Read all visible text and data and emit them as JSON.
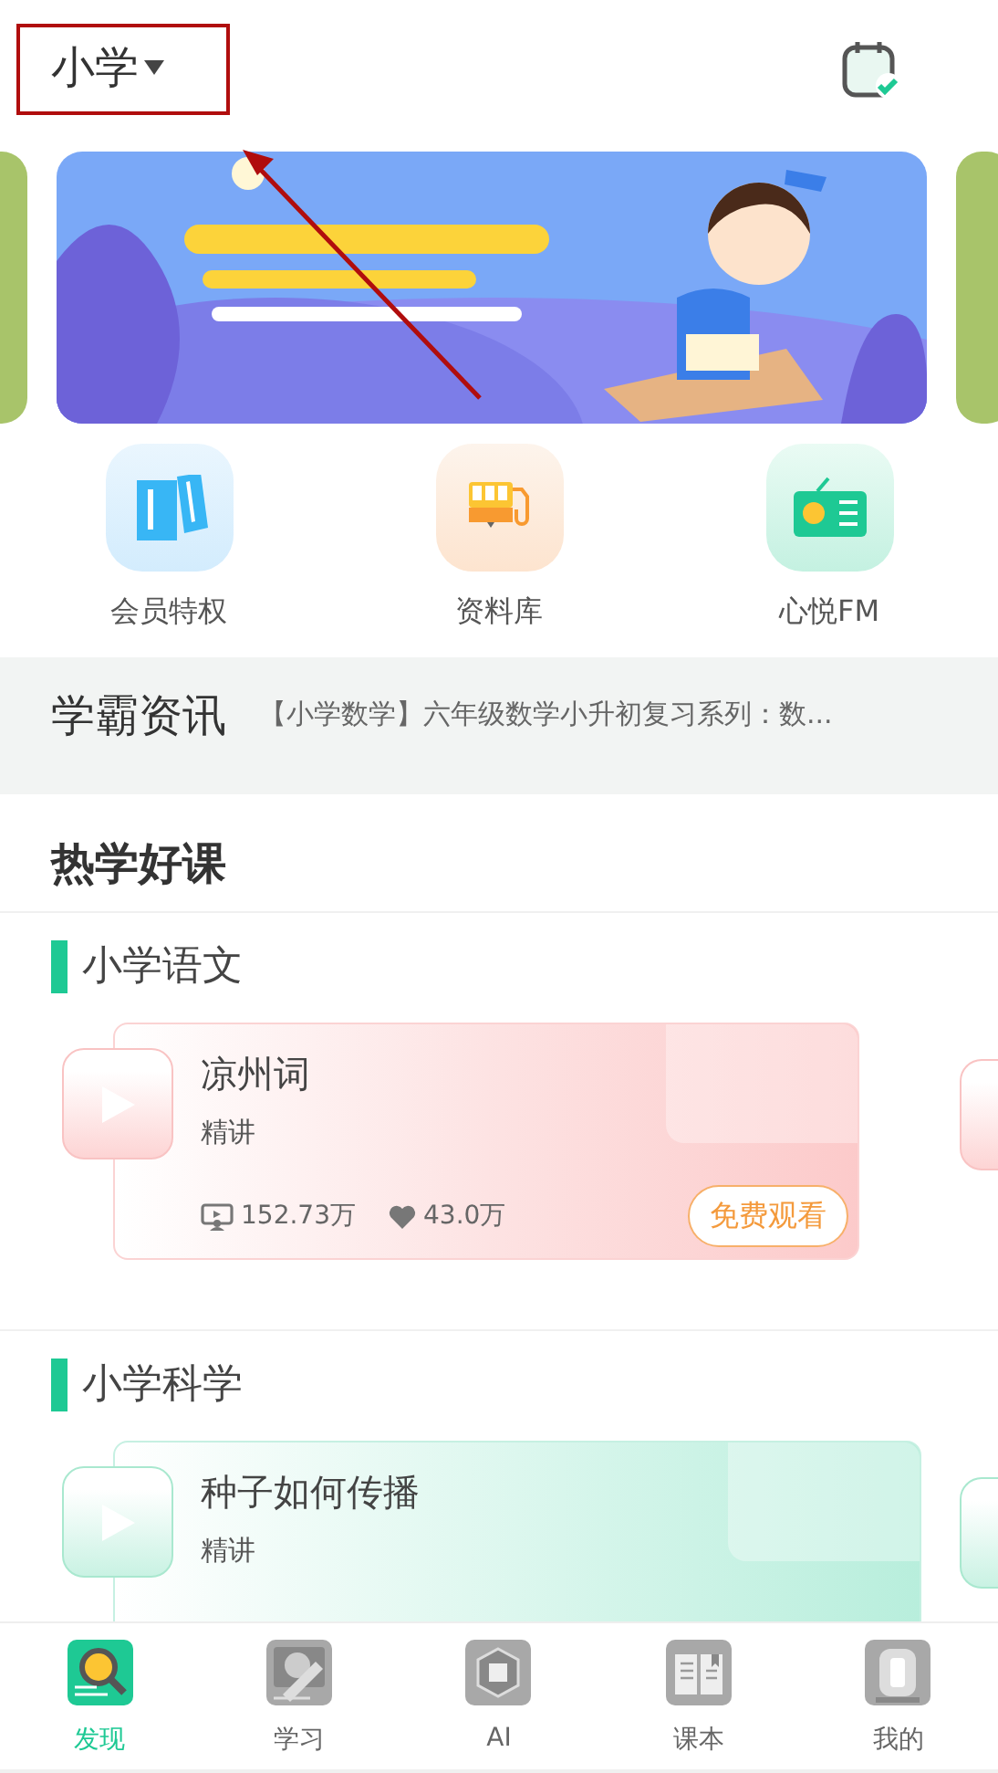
{
  "header": {
    "grade": "小学"
  },
  "quick_links": [
    {
      "label": "会员特权",
      "kind": "books"
    },
    {
      "label": "资料库",
      "kind": "library"
    },
    {
      "label": "心悦FM",
      "kind": "radio"
    }
  ],
  "news": {
    "title": "学霸资讯",
    "headline": "【小学数学】六年级数学小升初复习系列：数..."
  },
  "hot_courses": {
    "title": "热学好课",
    "sections": [
      {
        "subject": "小学语文",
        "kind": "pink",
        "course": {
          "title": "凉州词",
          "tag": "精讲",
          "views": "152.73万",
          "likes": "43.0万",
          "action": "免费观看"
        }
      },
      {
        "subject": "小学科学",
        "kind": "green",
        "course": {
          "title": "种子如何传播",
          "tag": "精讲"
        }
      }
    ]
  },
  "tabs": [
    {
      "label": "发现",
      "kind": "discover",
      "selected": true
    },
    {
      "label": "学习",
      "kind": "study",
      "selected": false
    },
    {
      "label": "AI",
      "kind": "ai",
      "selected": false
    },
    {
      "label": "课本",
      "kind": "textbook",
      "selected": false
    },
    {
      "label": "我的",
      "kind": "me",
      "selected": false
    }
  ]
}
